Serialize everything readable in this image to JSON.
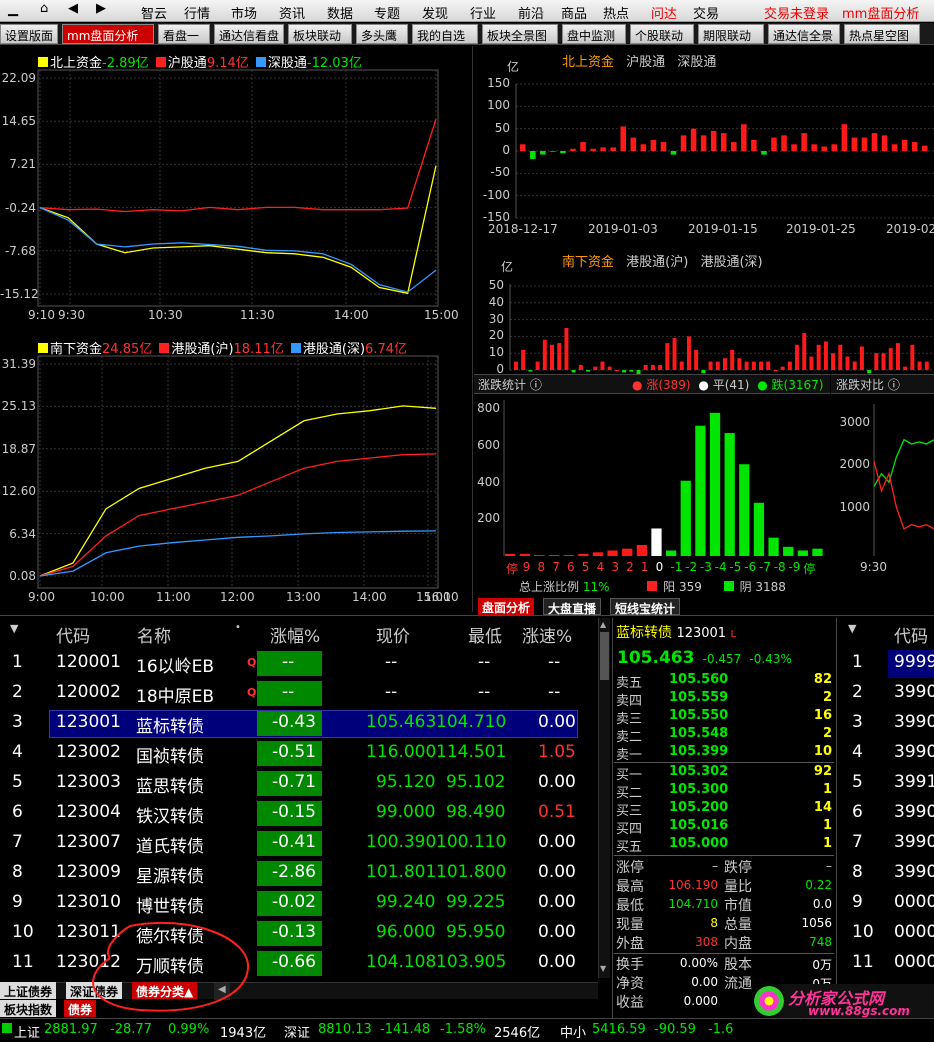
{
  "menu": {
    "items": [
      "智云",
      "行情",
      "市场",
      "资讯",
      "数据",
      "专题",
      "发现",
      "行业",
      "前沿",
      "商品",
      "热点",
      "问达",
      "交易"
    ],
    "right": [
      "交易未登录",
      "mm盘面分析"
    ]
  },
  "tabs": [
    "设置版面",
    "mm盘面分析",
    "看盘一",
    "通达信看盘",
    "板块联动",
    "多头鹰",
    "我的自选",
    "板块全景图",
    "盘中监测",
    "个股联动",
    "期限联动",
    "通达信全景",
    "热点星空图"
  ],
  "north": {
    "label": "北上资金",
    "value": "-2.89亿",
    "sh_label": "沪股通",
    "sh_value": "9.14亿",
    "sz_label": "深股通",
    "sz_value": "-12.03亿"
  },
  "south": {
    "label": "南下资金",
    "value": "24.85亿",
    "sh_label": "港股通(沪)",
    "sh_value": "18.11亿",
    "sz_label": "港股通(深)",
    "sz_value": "6.74亿"
  },
  "chart_data": [
    {
      "type": "line",
      "title": "北上资金",
      "y_ticks": [
        "22.09",
        "14.65",
        "7.21",
        "-0.24",
        "-7.68",
        "-15.12"
      ],
      "x_ticks": [
        "9:10",
        "9:30",
        "10:30",
        "11:30",
        "14:00",
        "15:00"
      ],
      "series": [
        {
          "name": "北上资金",
          "color": "#ffff00",
          "values": [
            -0.24,
            -2.0,
            -6.5,
            -8.0,
            -7.2,
            -7.0,
            -6.8,
            -7.4,
            -8.0,
            -8.2,
            -8.8,
            -10.5,
            -14.0,
            -15.0,
            7.0
          ]
        },
        {
          "name": "沪股通",
          "color": "#ff2020",
          "values": [
            -0.24,
            -0.6,
            -0.5,
            -0.9,
            -0.6,
            -0.8,
            -0.2,
            -0.6,
            -0.2,
            -0.2,
            -0.6,
            -0.6,
            -0.6,
            -0.3,
            15.0
          ]
        },
        {
          "name": "深股通",
          "color": "#3399ff",
          "values": [
            -0.24,
            -2.4,
            -6.5,
            -7.0,
            -6.5,
            -6.3,
            -6.6,
            -6.9,
            -7.6,
            -7.7,
            -8.2,
            -10.0,
            -13.5,
            -14.8,
            -11.0
          ]
        }
      ]
    },
    {
      "type": "line",
      "title": "南下资金",
      "y_ticks": [
        "31.39",
        "25.13",
        "18.87",
        "12.60",
        "6.34",
        "0.08"
      ],
      "x_ticks": [
        "9:00",
        "10:00",
        "11:00",
        "12:00",
        "13:00",
        "14:00",
        "15:00",
        "16:10"
      ],
      "series": [
        {
          "name": "南下资金",
          "color": "#ffff00",
          "values": [
            0.08,
            2.0,
            10.0,
            13.0,
            14.5,
            16.0,
            17.0,
            20.0,
            23.0,
            24.0,
            24.5,
            25.2,
            24.85
          ]
        },
        {
          "name": "港股通(沪)",
          "color": "#ff2020",
          "values": [
            0.08,
            1.5,
            6.0,
            9.0,
            10.0,
            11.0,
            12.0,
            14.0,
            16.0,
            17.0,
            17.5,
            18.0,
            18.11
          ]
        },
        {
          "name": "港股通(深)",
          "color": "#3399ff",
          "values": [
            0.08,
            0.8,
            3.5,
            4.5,
            5.0,
            5.4,
            5.8,
            6.0,
            6.3,
            6.5,
            6.6,
            6.7,
            6.74
          ]
        }
      ]
    },
    {
      "type": "bar",
      "title": "北上资金",
      "unit": "亿",
      "y_ticks": [
        "150",
        "100",
        "50",
        "0",
        "-50",
        "-100",
        "-150"
      ],
      "ylim": [
        -150,
        150
      ],
      "x_ticks": [
        "2018-12-17",
        "2019-01-03",
        "2019-01-15",
        "2019-01-25",
        "2019-02"
      ],
      "values": [
        15,
        -18,
        -8,
        0,
        -5,
        5,
        20,
        5,
        8,
        8,
        55,
        30,
        15,
        25,
        20,
        -8,
        35,
        50,
        35,
        45,
        40,
        20,
        60,
        25,
        -8,
        30,
        35,
        15,
        40,
        15,
        10,
        15,
        60,
        30,
        30,
        40,
        35,
        15,
        25,
        20,
        12
      ]
    },
    {
      "type": "bar",
      "title": "南下资金",
      "unit": "亿",
      "y_ticks": [
        "50",
        "40",
        "30",
        "20",
        "10",
        "0"
      ],
      "ylim": [
        0,
        50
      ],
      "values": [
        5,
        12,
        -2,
        5,
        18,
        15,
        16,
        25,
        -3,
        3,
        -2,
        2,
        5,
        2,
        0,
        -3,
        -2,
        -5,
        3,
        3,
        3,
        16,
        19,
        5,
        20,
        12,
        -4,
        5,
        5,
        7,
        12,
        7,
        5,
        5,
        5,
        5,
        0,
        2,
        5,
        15,
        22,
        8,
        15,
        17,
        10,
        15,
        8,
        5,
        14,
        -4,
        10,
        10,
        13,
        16,
        2,
        15,
        5,
        5
      ]
    },
    {
      "type": "bar",
      "title": "涨跌统计",
      "y_ticks": [
        "800",
        "600",
        "400",
        "200"
      ],
      "ylim": [
        0,
        850
      ],
      "categories": [
        "停",
        "9",
        "8",
        "7",
        "6",
        "5",
        "4",
        "3",
        "2",
        "1",
        "0",
        "-1",
        "-2",
        "-3",
        "-4",
        "-5",
        "-6",
        "-7",
        "-8",
        "-9",
        "停"
      ],
      "values": [
        12,
        12,
        5,
        5,
        5,
        12,
        20,
        30,
        40,
        60,
        150,
        30,
        410,
        710,
        780,
        670,
        500,
        290,
        100,
        50,
        30,
        40
      ]
    },
    {
      "type": "line",
      "title": "涨跌对比",
      "y_ticks": [
        "3000",
        "2000",
        "1000"
      ],
      "x_ticks": [
        "9:30"
      ],
      "series": [
        {
          "name": "跌",
          "color": "#00e600",
          "values": [
            1600,
            1900,
            1700,
            2300,
            2700,
            2600,
            2650,
            2600,
            2700
          ]
        },
        {
          "name": "涨",
          "color": "#ff2020",
          "values": [
            2200,
            1500,
            1900,
            1100,
            600,
            700,
            650,
            700,
            600
          ]
        }
      ]
    }
  ],
  "north_bar": {
    "label": "北上资金",
    "sh": "沪股通",
    "sz": "深股通",
    "unit": "亿"
  },
  "south_bar": {
    "label": "南下资金",
    "sh": "港股通(沪)",
    "sz": "港股通(深)",
    "unit": "亿"
  },
  "stats": {
    "title": "涨跌统计",
    "up": "涨(389)",
    "flat": "平(41)",
    "down": "跌(3167)",
    "ratio_label": "总上涨比例",
    "ratio": "11%",
    "yang": "阳 359",
    "yin": "阴 3188"
  },
  "compare": {
    "title": "涨跌对比",
    "x": "9:30"
  },
  "subtabs": [
    "盘面分析",
    "大盘直播",
    "短线宝统计"
  ],
  "table": {
    "headers": [
      "代码",
      "名称",
      "涨幅%",
      "现价",
      "最低",
      "涨速%"
    ],
    "rows": [
      {
        "n": "1",
        "code": "120001",
        "name": "16以岭EB",
        "q": "Q",
        "chg": "--",
        "price": "--",
        "low": "--",
        "spd": "--"
      },
      {
        "n": "2",
        "code": "120002",
        "name": "18中原EB",
        "q": "Q",
        "chg": "--",
        "price": "--",
        "low": "--",
        "spd": "--"
      },
      {
        "n": "3",
        "code": "123001",
        "name": "蓝标转债",
        "q": "",
        "chg": "-0.43",
        "price": "105.463",
        "low": "104.710",
        "spd": "0.00"
      },
      {
        "n": "4",
        "code": "123002",
        "name": "国祯转债",
        "q": "",
        "chg": "-0.51",
        "price": "116.000",
        "low": "114.501",
        "spd": "1.05"
      },
      {
        "n": "5",
        "code": "123003",
        "name": "蓝思转债",
        "q": "",
        "chg": "-0.71",
        "price": "95.120",
        "low": "95.102",
        "spd": "0.00"
      },
      {
        "n": "6",
        "code": "123004",
        "name": "铁汉转债",
        "q": "",
        "chg": "-0.15",
        "price": "99.000",
        "low": "98.490",
        "spd": "0.51"
      },
      {
        "n": "7",
        "code": "123007",
        "name": "道氏转债",
        "q": "",
        "chg": "-0.41",
        "price": "100.390",
        "low": "100.110",
        "spd": "0.00"
      },
      {
        "n": "8",
        "code": "123009",
        "name": "星源转债",
        "q": "",
        "chg": "-2.86",
        "price": "101.801",
        "low": "101.800",
        "spd": "0.00"
      },
      {
        "n": "9",
        "code": "123010",
        "name": "博世转债",
        "q": "",
        "chg": "-0.02",
        "price": "99.240",
        "low": "99.225",
        "spd": "0.00"
      },
      {
        "n": "10",
        "code": "123011",
        "name": "德尔转债",
        "q": "",
        "chg": "-0.13",
        "price": "96.000",
        "low": "95.950",
        "spd": "0.00"
      },
      {
        "n": "11",
        "code": "123012",
        "name": "万顺转债",
        "q": "",
        "chg": "-0.66",
        "price": "104.108",
        "low": "103.905",
        "spd": "0.00"
      }
    ]
  },
  "sheet_tabs": [
    "上证债券",
    "深证债券",
    "债券分类▲"
  ],
  "sheet_tabs2": [
    "板块指数",
    "债券"
  ],
  "quote": {
    "name": "蓝标转债",
    "code": "123001",
    "flag": "L",
    "price": "105.463",
    "chg": "-0.457",
    "pct": "-0.43%",
    "sell": [
      {
        "l": "卖五",
        "p": "105.560",
        "v": "82"
      },
      {
        "l": "卖四",
        "p": "105.559",
        "v": "2"
      },
      {
        "l": "卖三",
        "p": "105.550",
        "v": "16"
      },
      {
        "l": "卖二",
        "p": "105.548",
        "v": "2"
      },
      {
        "l": "卖一",
        "p": "105.399",
        "v": "10"
      }
    ],
    "buy": [
      {
        "l": "买一",
        "p": "105.302",
        "v": "92"
      },
      {
        "l": "买二",
        "p": "105.300",
        "v": "1"
      },
      {
        "l": "买三",
        "p": "105.200",
        "v": "14"
      },
      {
        "l": "买四",
        "p": "105.016",
        "v": "1"
      },
      {
        "l": "买五",
        "p": "105.000",
        "v": "1"
      }
    ],
    "info": [
      [
        "涨停",
        "–",
        "跌停",
        "–"
      ],
      [
        "最高",
        "106.190",
        "量比",
        "0.22"
      ],
      [
        "最低",
        "104.710",
        "市值",
        "0.0"
      ],
      [
        "现量",
        "8",
        "总量",
        "1056"
      ],
      [
        "外盘",
        "308",
        "内盘",
        "748"
      ],
      [
        "换手",
        "0.00%",
        "股本",
        "0万"
      ],
      [
        "净资",
        "0.00",
        "流通",
        "0万"
      ],
      [
        "收益",
        "0.000",
        "",
        ""
      ]
    ]
  },
  "right_list": {
    "header": "代码",
    "rows": [
      {
        "n": "1",
        "c": "9999"
      },
      {
        "n": "2",
        "c": "3990"
      },
      {
        "n": "3",
        "c": "3990"
      },
      {
        "n": "4",
        "c": "3990"
      },
      {
        "n": "5",
        "c": "3991"
      },
      {
        "n": "6",
        "c": "3990"
      },
      {
        "n": "7",
        "c": "3990"
      },
      {
        "n": "8",
        "c": "3990"
      },
      {
        "n": "9",
        "c": "0000"
      },
      {
        "n": "10",
        "c": "0000"
      },
      {
        "n": "11",
        "c": "0000"
      }
    ]
  },
  "status": {
    "sh_label": "上证",
    "sh_val": "2881.97",
    "sh_chg": "-28.77",
    "sh_pct": "0.99%",
    "sh_amt": "1943亿",
    "sz_label": "深证",
    "sz_val": "8810.13",
    "sz_chg": "-141.48",
    "sz_pct": "-1.58%",
    "sz_amt": "2546亿",
    "zx_label": "中小",
    "zx_val": "5416.59",
    "zx_chg": "-90.59",
    "zx_pct": "-1.6"
  },
  "watermark": {
    "text": "分析家公式网",
    "url": "www.88gs.com"
  }
}
